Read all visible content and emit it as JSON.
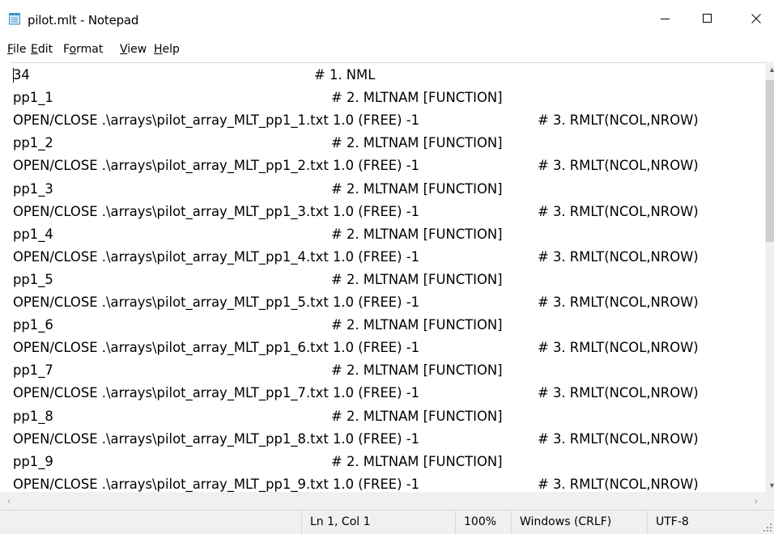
{
  "window": {
    "title": "pilot.mlt - Notepad",
    "app_icon": "notepad-icon",
    "controls": {
      "minimize": "minimize-icon",
      "maximize": "maximize-icon",
      "close": "close-icon"
    }
  },
  "menu": [
    {
      "pre": "",
      "key": "F",
      "post": "ile"
    },
    {
      "pre": "",
      "key": "E",
      "post": "dit"
    },
    {
      "pre": "F",
      "key": "o",
      "post": "rmat"
    },
    {
      "pre": "",
      "key": "V",
      "post": "iew"
    },
    {
      "pre": "",
      "key": "H",
      "post": "elp"
    }
  ],
  "editor": {
    "lines": [
      [
        "34",
        "# 1. NML"
      ],
      [
        "pp1_1",
        "# 2. MLTNAM [FUNCTION]"
      ],
      [
        "OPEN/CLOSE .\\arrays\\pilot_array_MLT_pp1_1.txt 1.0 (FREE) -1",
        "# 3. RMLT(NCOL,NROW)"
      ],
      [
        "pp1_2",
        "# 2. MLTNAM [FUNCTION]"
      ],
      [
        "OPEN/CLOSE .\\arrays\\pilot_array_MLT_pp1_2.txt 1.0 (FREE) -1",
        "# 3. RMLT(NCOL,NROW)"
      ],
      [
        "pp1_3",
        "# 2. MLTNAM [FUNCTION]"
      ],
      [
        "OPEN/CLOSE .\\arrays\\pilot_array_MLT_pp1_3.txt 1.0 (FREE) -1",
        "# 3. RMLT(NCOL,NROW)"
      ],
      [
        "pp1_4",
        "# 2. MLTNAM [FUNCTION]"
      ],
      [
        "OPEN/CLOSE .\\arrays\\pilot_array_MLT_pp1_4.txt 1.0 (FREE) -1",
        "# 3. RMLT(NCOL,NROW)"
      ],
      [
        "pp1_5",
        "# 2. MLTNAM [FUNCTION]"
      ],
      [
        "OPEN/CLOSE .\\arrays\\pilot_array_MLT_pp1_5.txt 1.0 (FREE) -1",
        "# 3. RMLT(NCOL,NROW)"
      ],
      [
        "pp1_6",
        "# 2. MLTNAM [FUNCTION]"
      ],
      [
        "OPEN/CLOSE .\\arrays\\pilot_array_MLT_pp1_6.txt 1.0 (FREE) -1",
        "# 3. RMLT(NCOL,NROW)"
      ],
      [
        "pp1_7",
        "# 2. MLTNAM [FUNCTION]"
      ],
      [
        "OPEN/CLOSE .\\arrays\\pilot_array_MLT_pp1_7.txt 1.0 (FREE) -1",
        "# 3. RMLT(NCOL,NROW)"
      ],
      [
        "pp1_8",
        "# 2. MLTNAM [FUNCTION]"
      ],
      [
        "OPEN/CLOSE .\\arrays\\pilot_array_MLT_pp1_8.txt 1.0 (FREE) -1",
        "# 3. RMLT(NCOL,NROW)"
      ],
      [
        "pp1_9",
        "# 2. MLTNAM [FUNCTION]"
      ],
      [
        "OPEN/CLOSE .\\arrays\\pilot_array_MLT_pp1_9.txt 1.0 (FREE) -1",
        "# 3. RMLT(NCOL,NROW)"
      ]
    ]
  },
  "statusbar": {
    "position": "Ln 1, Col 1",
    "zoom": "100%",
    "line_ending": "Windows (CRLF)",
    "encoding": "UTF-8"
  }
}
